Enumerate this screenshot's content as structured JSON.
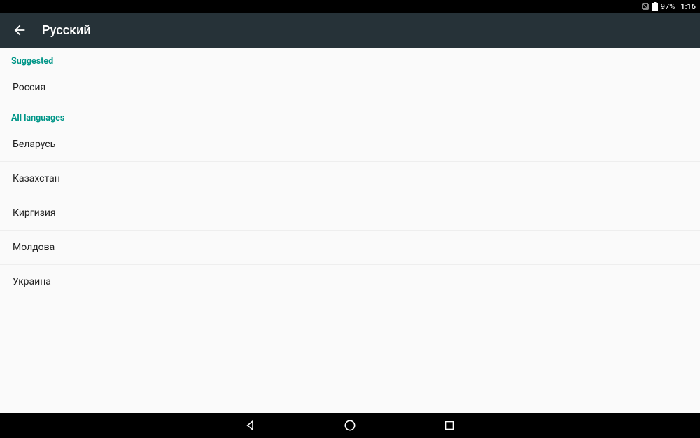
{
  "status": {
    "battery_pct": "97%",
    "time": "1:16"
  },
  "header": {
    "title": "Русский"
  },
  "sections": {
    "suggested_label": "Suggested",
    "suggested_items": [
      "Россия"
    ],
    "all_label": "All languages",
    "all_items": [
      "Беларусь",
      "Казахстан",
      "Киргизия",
      "Молдова",
      "Украина"
    ]
  }
}
